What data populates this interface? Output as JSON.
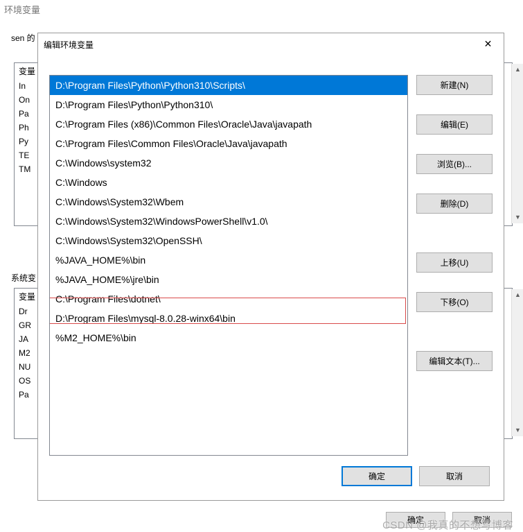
{
  "bg": {
    "window_title": "环境变量",
    "user_section_label": "sen 的",
    "user_var_header": "变量",
    "user_rows": [
      "In",
      "On",
      "Pa",
      "Ph",
      "Py",
      "TE",
      "TM",
      ""
    ],
    "sys_section_label": "系统变",
    "sys_var_header": "变量",
    "sys_rows": [
      "Dr",
      "GR",
      "JA",
      "M2",
      "NU",
      "OS",
      "Pa",
      ""
    ],
    "ok": "确定",
    "cancel": "取消"
  },
  "fg": {
    "title": "编辑环境变量",
    "close_glyph": "✕",
    "entries": [
      "D:\\Program Files\\Python\\Python310\\Scripts\\",
      "D:\\Program Files\\Python\\Python310\\",
      "C:\\Program Files (x86)\\Common Files\\Oracle\\Java\\javapath",
      "C:\\Program Files\\Common Files\\Oracle\\Java\\javapath",
      "C:\\Windows\\system32",
      "C:\\Windows",
      "C:\\Windows\\System32\\Wbem",
      "C:\\Windows\\System32\\WindowsPowerShell\\v1.0\\",
      "C:\\Windows\\System32\\OpenSSH\\",
      "%JAVA_HOME%\\bin",
      "%JAVA_HOME%\\jre\\bin",
      "C:\\Program Files\\dotnet\\",
      "D:\\Program Files\\mysql-8.0.28-winx64\\bin",
      "%M2_HOME%\\bin"
    ],
    "selected_index": 0,
    "highlighted_index": 13,
    "buttons": {
      "new": "新建(N)",
      "edit": "编辑(E)",
      "browse": "浏览(B)...",
      "delete": "删除(D)",
      "moveup": "上移(U)",
      "movedown": "下移(O)",
      "edittext": "编辑文本(T)...",
      "ok": "确定",
      "cancel": "取消"
    }
  },
  "watermark": "CSDN @我真的不想写博客"
}
